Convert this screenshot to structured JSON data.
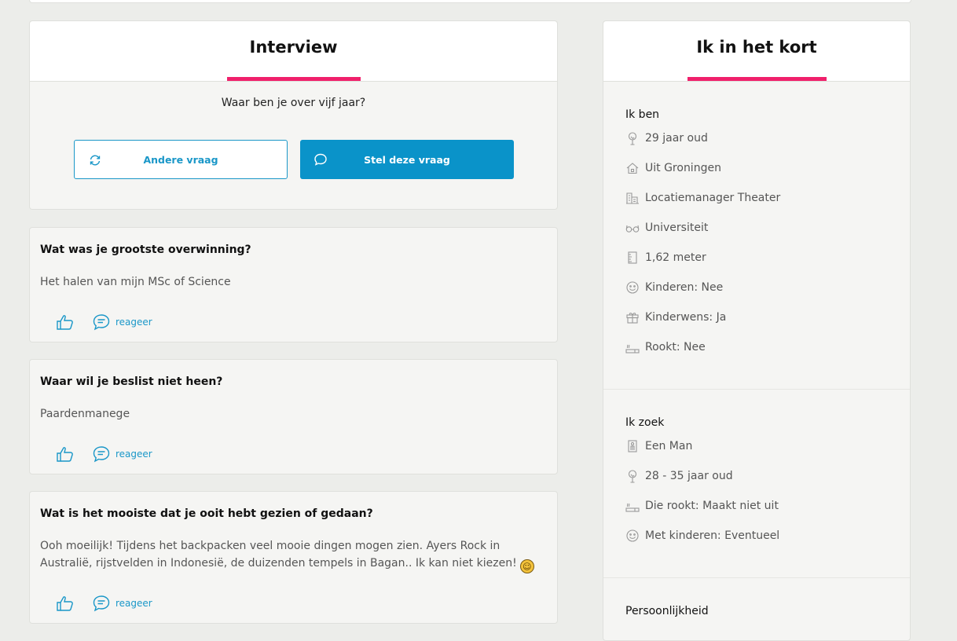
{
  "interview": {
    "title": "Interview",
    "question": "Waar ben je over vijf jaar?",
    "other_button": "Andere vraag",
    "ask_button": "Stel deze vraag"
  },
  "qa": [
    {
      "question": "Wat was je grootste overwinning?",
      "answer": "Het halen van mijn MSc of Science",
      "react_label": "reageer"
    },
    {
      "question": "Waar wil je beslist niet heen?",
      "answer": "Paardenmanege",
      "react_label": "reageer"
    },
    {
      "question": "Wat is het mooiste dat je ooit hebt gezien of gedaan?",
      "answer": "Ooh moeilijk! Tijdens het backpacken veel mooie dingen mogen zien. Ayers Rock in Australië, rijstvelden in Indonesië, de duizenden tempels in Bagan.. Ik kan niet kiezen!",
      "react_label": "reageer"
    }
  ],
  "side": {
    "title": "Ik in het kort",
    "ik_ben": {
      "title": "Ik ben",
      "items": [
        {
          "icon": "tree-icon",
          "text": "29 jaar oud"
        },
        {
          "icon": "house-icon",
          "text": "Uit Groningen"
        },
        {
          "icon": "building-icon",
          "text": "Locatiemanager Theater"
        },
        {
          "icon": "glasses-icon",
          "text": "Universiteit"
        },
        {
          "icon": "ruler-icon",
          "text": "1,62 meter"
        },
        {
          "icon": "smiley-icon",
          "text": "Kinderen: Nee"
        },
        {
          "icon": "gift-icon",
          "text": "Kinderwens: Ja"
        },
        {
          "icon": "cigarette-icon",
          "text": "Rookt: Nee"
        }
      ]
    },
    "ik_zoek": {
      "title": "Ik zoek",
      "items": [
        {
          "icon": "person-icon",
          "text": "Een Man"
        },
        {
          "icon": "tree-icon",
          "text": "28 - 35 jaar oud"
        },
        {
          "icon": "cigarette-icon",
          "text": "Die rookt: Maakt niet uit"
        },
        {
          "icon": "smiley-icon",
          "text": "Met kinderen: Eventueel"
        }
      ]
    },
    "persoonlijkheid": {
      "title": "Persoonlijkheid"
    }
  },
  "colors": {
    "accent_pink": "#f0206b",
    "accent_blue": "#0a93c9",
    "background": "#ecedea"
  }
}
